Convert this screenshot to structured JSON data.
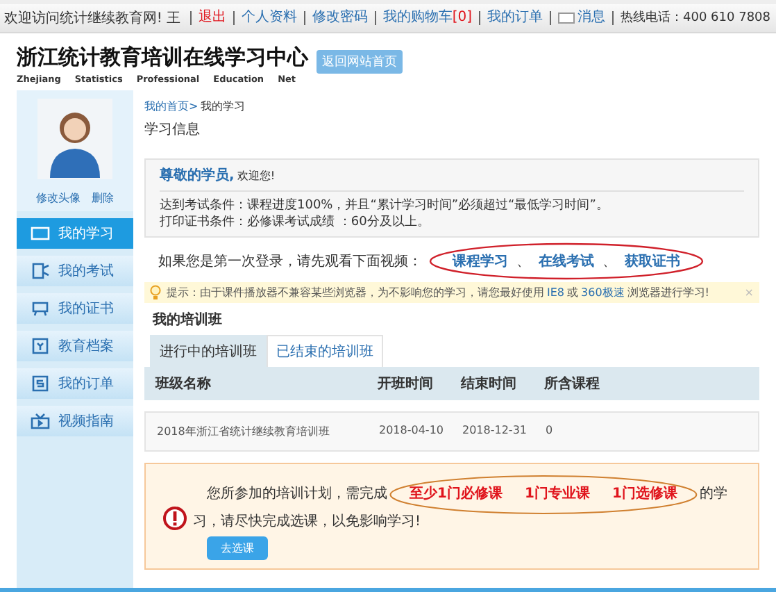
{
  "top_bar": {
    "welcome": "欢迎访问统计继续教育网!",
    "user": "王",
    "links": [
      {
        "label": "退出",
        "kind": "danger"
      },
      {
        "label": "个人资料",
        "kind": "link"
      },
      {
        "label": "修改密码",
        "kind": "link"
      },
      {
        "label": "我的购物车",
        "count": "[0]",
        "kind": "link"
      },
      {
        "label": "我的订单",
        "kind": "link"
      },
      {
        "label": "消息",
        "kind": "message"
      }
    ],
    "hotline": "热线电话：400 610 7808"
  },
  "logo": {
    "title": "浙江统计教育培训在线学习中心",
    "subtitle": [
      "Zhejiang",
      "Statistics",
      "Professional",
      "Education",
      "Net"
    ],
    "home_button": "返回网站首页"
  },
  "sidebar": {
    "avatar_actions": [
      "修改头像",
      "删除"
    ],
    "items": [
      {
        "label": "我的学习",
        "selected": true
      },
      {
        "label": "我的考试",
        "selected": false
      },
      {
        "label": "我的证书",
        "selected": false
      },
      {
        "label": "教育档案",
        "selected": false
      },
      {
        "label": "我的订单",
        "selected": false
      },
      {
        "label": "视频指南",
        "selected": false
      }
    ]
  },
  "breadcrumb": [
    {
      "label": "我的首页>",
      "link": true
    },
    {
      "label": "我的学习",
      "link": false
    }
  ],
  "title": "学习信息",
  "notice": {
    "greeting": "尊敬的学员,",
    "greeting_suffix": "欢迎您!",
    "lines": [
      "达到考试条件：课程进度100%，并且“累计学习时间”必须超过“最低学习时间”。",
      "打印证书条件：必修课考试成绩 ：60分及以上。"
    ]
  },
  "intro": {
    "text": "如果您是第一次登录，请先观看下面视频：",
    "separator": "、",
    "links": [
      "课程学习",
      "在线考试",
      "获取证书"
    ]
  },
  "tip": {
    "segments": [
      {
        "text": "提示：由于课件播放器不兼容某些浏览器，为不影响您的学习，请您最好使用",
        "kind": "text"
      },
      {
        "text": "IE8",
        "kind": "link"
      },
      {
        "text": "或",
        "kind": "text"
      },
      {
        "text": "360极速",
        "kind": "link"
      },
      {
        "text": "浏览器进行学习!",
        "kind": "text"
      }
    ],
    "close": "×"
  },
  "training": {
    "title": "我的培训班",
    "tabs": [
      {
        "label": "进行中的培训班",
        "selected": true
      },
      {
        "label": "已结束的培训班",
        "selected": false
      }
    ],
    "columns": [
      "班级名称",
      "开班时间",
      "结束时间",
      "所含课程"
    ],
    "rows": [
      [
        "2018年浙江省统计继续教育培训班",
        "2018-04-10",
        "2018-12-31",
        "0"
      ]
    ]
  },
  "alert": {
    "text_before": "您所参加的培训计划，需完成",
    "highlights": [
      "至少1门必修课",
      "1门专业课",
      "1门选修课"
    ],
    "text_after": "的学习，请尽快完成选课，以免影响学习!",
    "button": "去选课"
  }
}
